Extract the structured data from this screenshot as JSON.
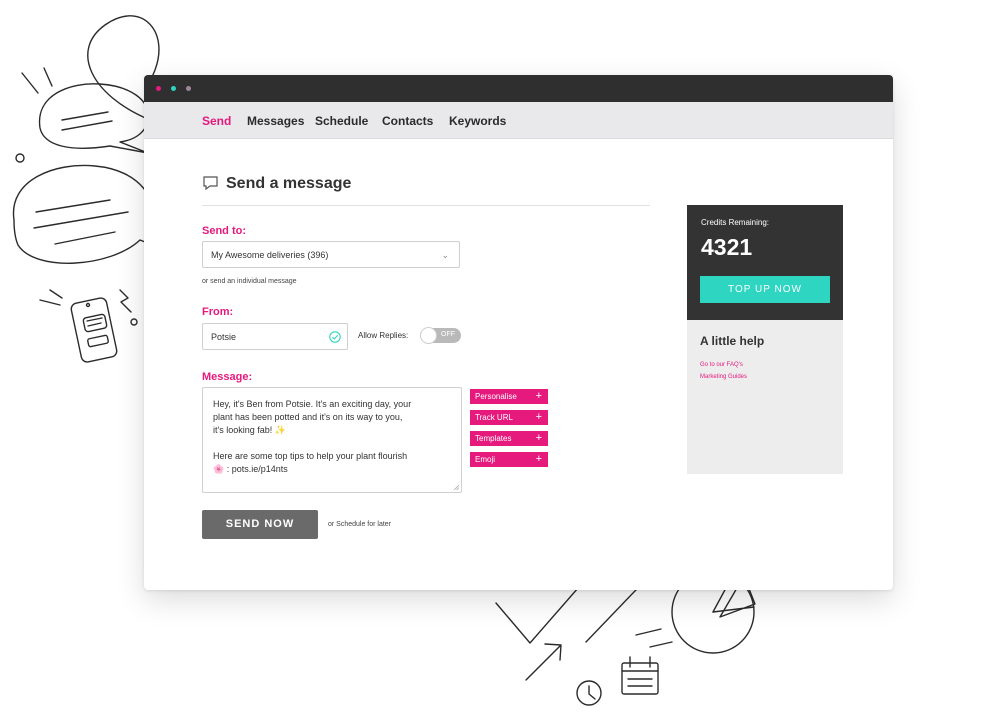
{
  "colors": {
    "accent": "#e6197d",
    "teal": "#2ed5c0",
    "dark": "#333333",
    "dot1": "#e6197d",
    "dot2": "#2ed5c0",
    "dot3": "#a0869a"
  },
  "nav": {
    "items": [
      {
        "label": "Send",
        "active": true
      },
      {
        "label": "Messages",
        "active": false
      },
      {
        "label": "Schedule",
        "active": false
      },
      {
        "label": "Contacts",
        "active": false
      },
      {
        "label": "Keywords",
        "active": false
      }
    ]
  },
  "page": {
    "title": "Send a message",
    "title_icon": "chat-bubble-icon"
  },
  "send_to": {
    "label": "Send to:",
    "selected": "My Awesome deliveries (396)",
    "note": "or send an individual message"
  },
  "from": {
    "label": "From:",
    "value": "Potsie",
    "allow_replies_label": "Allow Replies:",
    "toggle_state": "OFF"
  },
  "message": {
    "label": "Message:",
    "lines": [
      "Hey, it's Ben from Potsie. It's an exciting day, your",
      "plant has been potted and it's on its way to you,",
      "it's looking fab! ✨",
      "Here are some top tips to help your plant flourish",
      "🌸 : pots.ie/p14nts"
    ],
    "actions": [
      "Personalise",
      "Track URL",
      "Templates",
      "Emoji"
    ],
    "plus": "+"
  },
  "send": {
    "button_label": "SEND NOW",
    "schedule_link": "or Schedule for later"
  },
  "credits": {
    "label": "Credits Remaining:",
    "value": "4321",
    "topup_label": "TOP UP NOW"
  },
  "help": {
    "title": "A little help",
    "links": [
      "Go to our FAQ's",
      "Marketing Guides"
    ]
  }
}
